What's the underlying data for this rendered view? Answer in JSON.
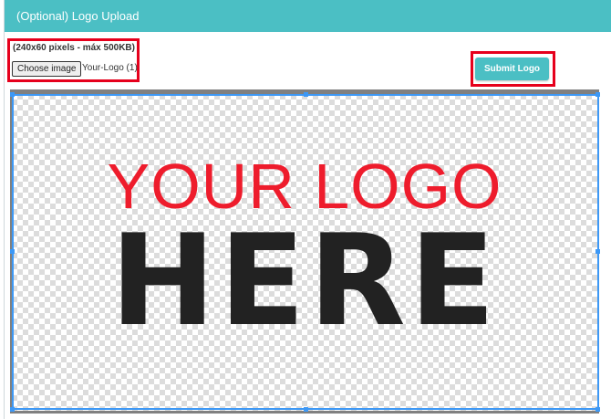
{
  "panel": {
    "title": "(Optional) Logo Upload"
  },
  "upload": {
    "size_hint": "(240x60 pixels - máx 500KB)",
    "choose_label": "Choose image",
    "file_name": "Your-Logo (1)"
  },
  "submit": {
    "label": "Submit Logo"
  },
  "logo_image": {
    "line1": "YOUR LOGO",
    "line2": "HERE"
  },
  "colors": {
    "header": "#4bbfc4",
    "highlight": "#e6001c",
    "crop_frame": "#3d98f5",
    "logo_red": "#ee1c2c",
    "logo_dark": "#222222"
  }
}
